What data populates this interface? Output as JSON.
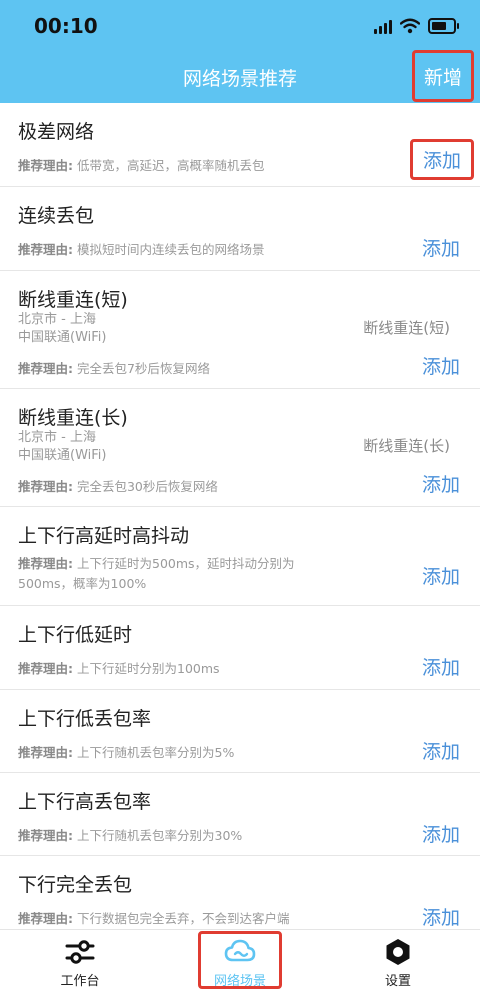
{
  "status_bar": {
    "time": "00:10"
  },
  "nav": {
    "title": "网络场景推荐",
    "right_button": "新增"
  },
  "desc_label": "推荐理由:",
  "add_label": "添加",
  "items": [
    {
      "title": "极差网络",
      "reason": "低带宽，高延迟，高概率随机丢包"
    },
    {
      "title": "连续丢包",
      "reason": "模拟短时间内连续丢包的网络场景"
    },
    {
      "title": "断线重连(短)",
      "location": "北京市 - 上海",
      "carrier": "中国联通(WiFi)",
      "tag": "断线重连(短)",
      "reason": "完全丢包7秒后恢复网络"
    },
    {
      "title": "断线重连(长)",
      "location": "北京市 - 上海",
      "carrier": "中国联通(WiFi)",
      "tag": "断线重连(长)",
      "reason": "完全丢包30秒后恢复网络"
    },
    {
      "title": "上下行高延时高抖动",
      "reason": "上下行延时为500ms，延时抖动分别为",
      "reason2": "500ms，概率为100%"
    },
    {
      "title": "上下行低延时",
      "reason": "上下行延时分别为100ms"
    },
    {
      "title": "上下行低丢包率",
      "reason": "上下行随机丢包率分别为5%"
    },
    {
      "title": "上下行高丢包率",
      "reason": "上下行随机丢包率分别为30%"
    },
    {
      "title": "下行完全丢包",
      "reason": "下行数据包完全丢弃，不会到达客户端"
    }
  ],
  "tabs": [
    {
      "label": "工作台",
      "icon": "sliders-icon"
    },
    {
      "label": "网络场景",
      "icon": "cloud-icon",
      "active": true,
      "active_color": "#5ec4f2"
    },
    {
      "label": "设置",
      "icon": "hexagon-settings-icon"
    }
  ],
  "colors": {
    "header": "#5ec4f2",
    "accent": "#4a90d9",
    "highlight": "#e03c31"
  }
}
